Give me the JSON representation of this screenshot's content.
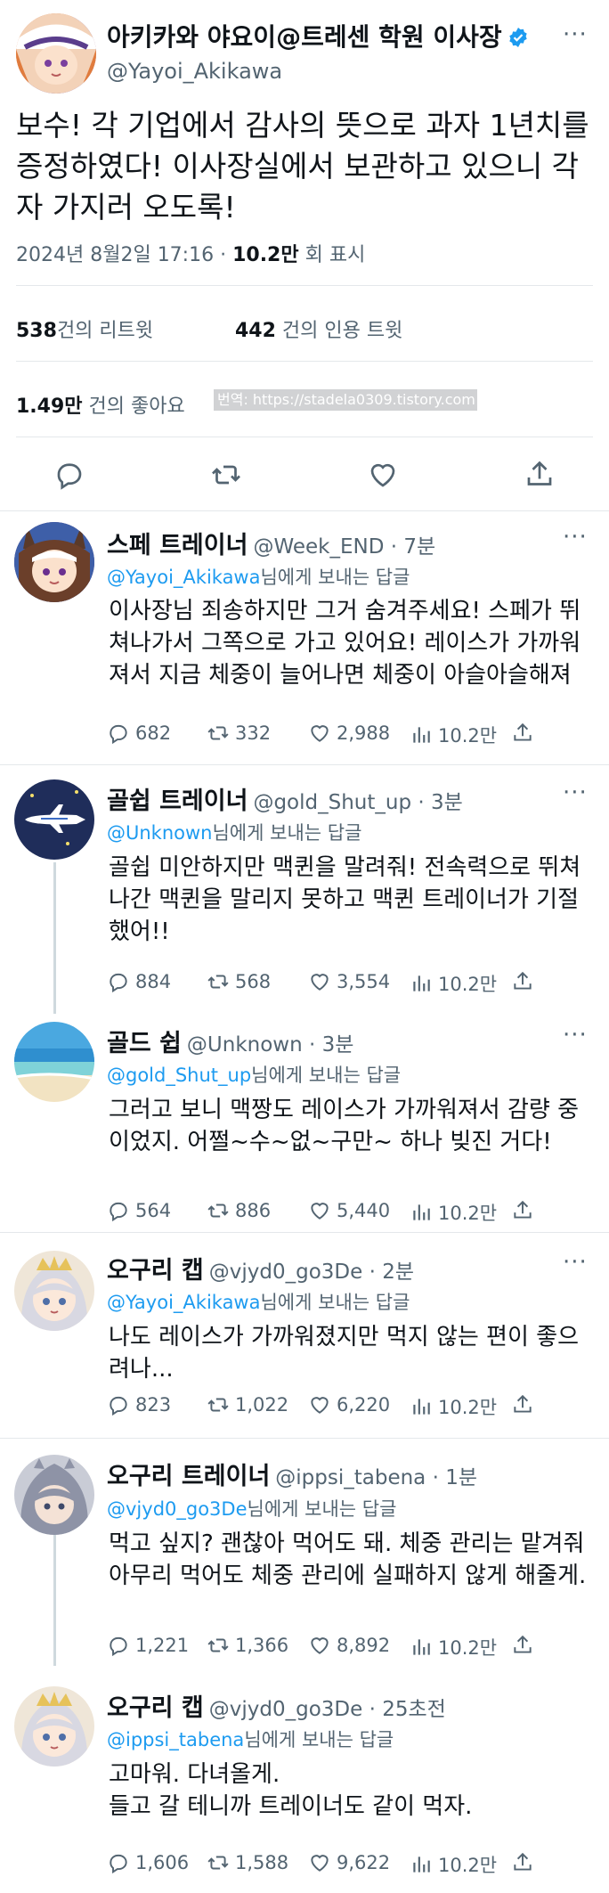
{
  "main_tweet": {
    "author_name": "아키카와 야요이@트레센 학원 이사장",
    "handle": "@Yayoi_Akikawa",
    "text": "보수! 각 기업에서 감사의 뜻으로 과자 1년치를 증정하였다! 이사장실에서 보관하고 있으니 각자 가지러 오도록!",
    "date": "2024년 8월2일  17:16 · ",
    "views_count": "10.2만",
    "views_label": " 회 표시",
    "retweets_count": "538",
    "retweets_label": "건의 리트윗",
    "quotes_count": "442",
    "quotes_label": " 건의 인용 트윗",
    "likes_count": "1.49만",
    "likes_label": " 건의 좋아요",
    "watermark": "번역: https://stadela0309.tistory.com",
    "more_label": "···"
  },
  "colors": {
    "accent": "#1d9bf0",
    "secondary_text": "#536471",
    "divider": "#e4e8eb"
  },
  "reply_to_suffix": "님에게 보내는 답글",
  "replies": [
    {
      "name": "스페 트레이너",
      "handle": "@Week_END",
      "time": " · 7분",
      "reply_to": "@Yayoi_Akikawa",
      "text": "이사장님 죄송하지만 그거 숨겨주세요! 스페가 뛰쳐나가서 그쪽으로 가고 있어요! 레이스가 가까워져서 지금 체중이 늘어나면 체중이 아슬아슬해져",
      "replies": "682",
      "retweets": "332",
      "likes": "2,988",
      "views": "10.2만",
      "avatar_icon": "horse-girl-avatar-icon"
    },
    {
      "name": "골쉽 트레이너",
      "handle": "@gold_Shut_up",
      "time": " · 3분",
      "reply_to": "@Unknown",
      "text": "골쉽 미안하지만 맥퀸을 말려줘! 전속력으로 뛰쳐나간 맥퀸을 말리지 못하고 맥퀸 트레이너가 기절했어!!",
      "replies": "884",
      "retweets": "568",
      "likes": "3,554",
      "views": "10.2만",
      "avatar_icon": "airplane-avatar-icon"
    },
    {
      "name": "골드 쉽",
      "handle": "@Unknown",
      "time": " · 3분",
      "reply_to": "@gold_Shut_up",
      "text": "그러고 보니 맥짱도 레이스가 가까워져서 감량 중이었지. 어쩔~수~없~구만~ 하나 빚진 거다!",
      "replies": "564",
      "retweets": "886",
      "likes": "5,440",
      "views": "10.2만",
      "avatar_icon": "beach-avatar-icon"
    },
    {
      "name": "오구리 캡",
      "handle": "@vjyd0_go3De",
      "time": " · 2분",
      "reply_to": "@Yayoi_Akikawa",
      "text": "나도 레이스가 가까워졌지만 먹지 않는 편이 좋으려나...",
      "replies": "823",
      "retweets": "1,022",
      "likes": "6,220",
      "views": "10.2만",
      "avatar_icon": "silver-hair-girl-avatar-icon"
    },
    {
      "name": "오구리 트레이너",
      "handle": "@ippsi_tabena",
      "time": " · 1분",
      "reply_to": "@vjyd0_go3De",
      "text": "먹고 싶지? 괜찮아 먹어도 돼. 체중 관리는 맡겨줘 아무리 먹어도 체중 관리에 실패하지 않게 해줄게.",
      "replies": "1,221",
      "retweets": "1,366",
      "likes": "8,892",
      "views": "10.2만",
      "avatar_icon": "grey-hair-girl-avatar-icon"
    },
    {
      "name": "오구리 캡",
      "handle": "@vjyd0_go3De",
      "time": " · 25초전",
      "reply_to": "@ippsi_tabena",
      "text": "고마워. 다녀올게.\n들고 갈 테니까 트레이너도 같이 먹자.",
      "replies": "1,606",
      "retweets": "1,588",
      "likes": "9,622",
      "views": "10.2만",
      "avatar_icon": "silver-hair-girl-avatar-icon"
    }
  ]
}
